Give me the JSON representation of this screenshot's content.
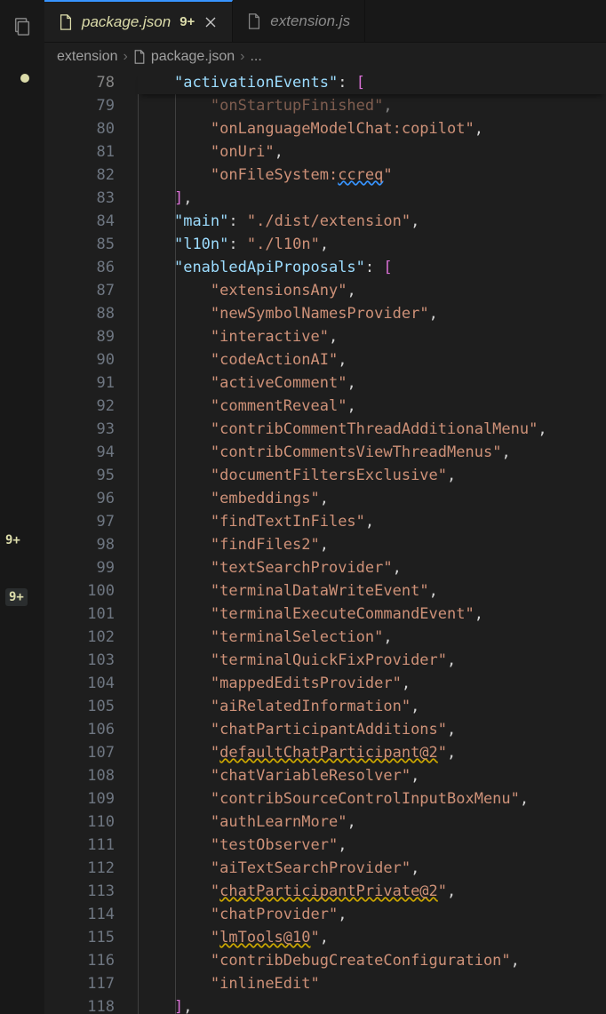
{
  "activity": {
    "badge1": "9+",
    "badge2": "9+"
  },
  "tabs": [
    {
      "name": "package.json",
      "badge": "9+",
      "active": true,
      "closeable": true
    },
    {
      "name": "extension.js",
      "badge": "",
      "active": false,
      "closeable": false
    }
  ],
  "breadcrumb": {
    "seg1": "extension",
    "seg2": "package.json",
    "seg3": "..."
  },
  "gutter": [
    "78",
    "79",
    "80",
    "81",
    "82",
    "83",
    "84",
    "85",
    "86",
    "87",
    "88",
    "89",
    "90",
    "91",
    "92",
    "93",
    "94",
    "95",
    "96",
    "97",
    "98",
    "99",
    "100",
    "101",
    "102",
    "103",
    "104",
    "105",
    "106",
    "107",
    "108",
    "109",
    "110",
    "111",
    "112",
    "113",
    "114",
    "115",
    "116",
    "117",
    "118"
  ],
  "code": {
    "sticky_key": "activationEvents",
    "l79": "onStartupFinished",
    "l80": "onLanguageModelChat:copilot",
    "l81": "onUri",
    "l82_pre": "onFileSystem:",
    "l82_warn": "ccreq",
    "l84_key": "main",
    "l84_val": "./dist/extension",
    "l85_key": "l10n",
    "l85_val": "./l10n",
    "l86_key": "enabledApiProposals",
    "arr": [
      "extensionsAny",
      "newSymbolNamesProvider",
      "interactive",
      "codeActionAI",
      "activeComment",
      "commentReveal",
      "contribCommentThreadAdditionalMenu",
      "contribCommentsViewThreadMenus",
      "documentFiltersExclusive",
      "embeddings",
      "findTextInFiles",
      "findFiles2",
      "textSearchProvider",
      "terminalDataWriteEvent",
      "terminalExecuteCommandEvent",
      "terminalSelection",
      "terminalQuickFixProvider",
      "mappedEditsProvider",
      "aiRelatedInformation",
      "chatParticipantAdditions",
      "defaultChatParticipant@2",
      "chatVariableResolver",
      "contribSourceControlInputBoxMenu",
      "authLearnMore",
      "testObserver",
      "aiTextSearchProvider",
      "chatParticipantPrivate@2",
      "chatProvider",
      "lmTools@10",
      "contribDebugCreateConfiguration",
      "inlineEdit"
    ]
  }
}
